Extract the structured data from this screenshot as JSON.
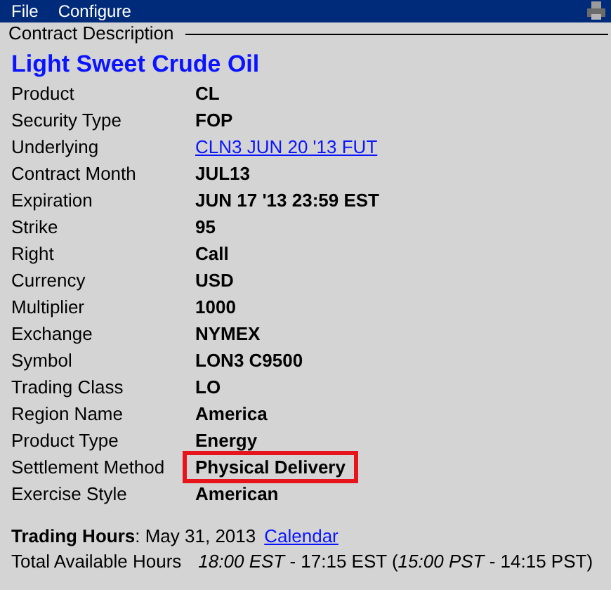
{
  "menu": [
    "File",
    "Configure"
  ],
  "section": {
    "title": "Contract Description"
  },
  "heading": "Light Sweet Crude Oil",
  "rows": [
    {
      "label": "Product",
      "value": "CL",
      "kind": "text",
      "highlighted": false
    },
    {
      "label": "Security Type",
      "value": "FOP",
      "kind": "text",
      "highlighted": false
    },
    {
      "label": "Underlying",
      "value": "CLN3 JUN 20 '13 FUT",
      "kind": "link",
      "highlighted": false
    },
    {
      "label": "Contract Month",
      "value": "JUL13",
      "kind": "text",
      "highlighted": false
    },
    {
      "label": "Expiration",
      "value": "JUN 17 '13 23:59 EST",
      "kind": "text",
      "highlighted": false
    },
    {
      "label": "Strike",
      "value": "95",
      "kind": "text",
      "highlighted": false
    },
    {
      "label": "Right",
      "value": "Call",
      "kind": "text",
      "highlighted": false
    },
    {
      "label": "Currency",
      "value": "USD",
      "kind": "text",
      "highlighted": false
    },
    {
      "label": "Multiplier",
      "value": "1000",
      "kind": "text",
      "highlighted": false
    },
    {
      "label": "Exchange",
      "value": "NYMEX",
      "kind": "text",
      "highlighted": false
    },
    {
      "label": "Symbol",
      "value": "LON3 C9500",
      "kind": "text",
      "highlighted": false
    },
    {
      "label": "Trading Class",
      "value": "LO",
      "kind": "text",
      "highlighted": false
    },
    {
      "label": "Region Name",
      "value": "America",
      "kind": "text",
      "highlighted": false
    },
    {
      "label": "Product Type",
      "value": "Energy",
      "kind": "text",
      "highlighted": false
    },
    {
      "label": "Settlement Method",
      "value": "Physical Delivery",
      "kind": "text",
      "highlighted": true
    },
    {
      "label": "Exercise Style",
      "value": "American",
      "kind": "text",
      "highlighted": false
    }
  ],
  "trading_hours": {
    "text": "**Trading Hours**: May 31, 2013",
    "link": "Calendar"
  },
  "total_hours": {
    "label": "Total Available Hours",
    "value": "*18:00 EST* - 17:15 EST (*15:00 PST* - 14:15 PST)"
  }
}
